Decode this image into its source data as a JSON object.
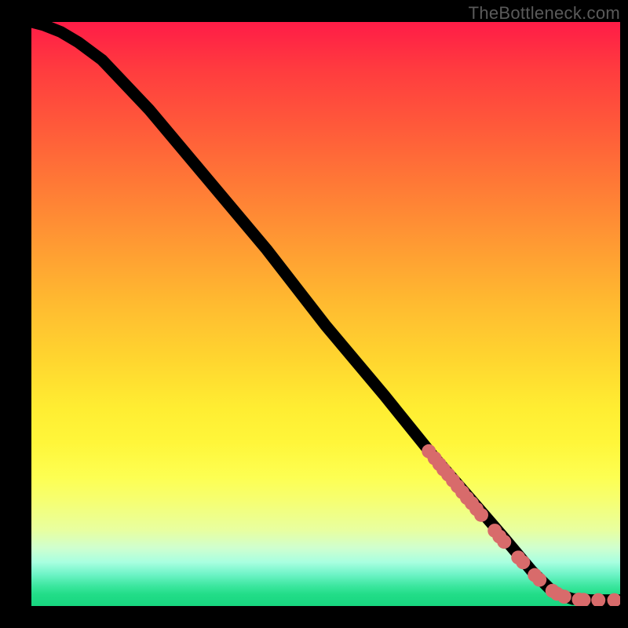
{
  "watermark": "TheBottleneck.com",
  "chart_data": {
    "type": "line",
    "title": "",
    "xlabel": "",
    "ylabel": "",
    "xlim": [
      0,
      100
    ],
    "ylim": [
      0,
      100
    ],
    "curve": [
      {
        "x": 0,
        "y": 100
      },
      {
        "x": 2,
        "y": 99.5
      },
      {
        "x": 5,
        "y": 98.3
      },
      {
        "x": 8,
        "y": 96.5
      },
      {
        "x": 12,
        "y": 93.5
      },
      {
        "x": 20,
        "y": 85
      },
      {
        "x": 30,
        "y": 73
      },
      {
        "x": 40,
        "y": 61
      },
      {
        "x": 50,
        "y": 48
      },
      {
        "x": 60,
        "y": 36
      },
      {
        "x": 68,
        "y": 26
      },
      {
        "x": 74,
        "y": 19
      },
      {
        "x": 80,
        "y": 12
      },
      {
        "x": 85,
        "y": 6
      },
      {
        "x": 88,
        "y": 3
      },
      {
        "x": 90,
        "y": 1.8
      },
      {
        "x": 92,
        "y": 1.2
      },
      {
        "x": 95,
        "y": 1.0
      },
      {
        "x": 100,
        "y": 1.0
      }
    ],
    "markers": [
      {
        "x": 67.5,
        "y": 26.5,
        "r": 1.2
      },
      {
        "x": 68.5,
        "y": 25.3,
        "r": 1.2
      },
      {
        "x": 69.3,
        "y": 24.3,
        "r": 1.2
      },
      {
        "x": 70.0,
        "y": 23.4,
        "r": 1.2
      },
      {
        "x": 70.8,
        "y": 22.5,
        "r": 1.2
      },
      {
        "x": 71.6,
        "y": 21.5,
        "r": 1.2
      },
      {
        "x": 72.4,
        "y": 20.5,
        "r": 1.2
      },
      {
        "x": 73.2,
        "y": 19.5,
        "r": 1.2
      },
      {
        "x": 74.0,
        "y": 18.5,
        "r": 1.2
      },
      {
        "x": 74.8,
        "y": 17.6,
        "r": 1.2
      },
      {
        "x": 75.6,
        "y": 16.6,
        "r": 1.2
      },
      {
        "x": 76.4,
        "y": 15.6,
        "r": 1.2
      },
      {
        "x": 78.7,
        "y": 12.9,
        "r": 1.2
      },
      {
        "x": 79.5,
        "y": 11.9,
        "r": 1.2
      },
      {
        "x": 80.3,
        "y": 11.0,
        "r": 1.2
      },
      {
        "x": 82.7,
        "y": 8.3,
        "r": 1.2
      },
      {
        "x": 83.5,
        "y": 7.5,
        "r": 1.2
      },
      {
        "x": 85.5,
        "y": 5.3,
        "r": 1.2
      },
      {
        "x": 86.3,
        "y": 4.5,
        "r": 1.2
      },
      {
        "x": 88.5,
        "y": 2.6,
        "r": 1.2
      },
      {
        "x": 89.3,
        "y": 2.1,
        "r": 1.2
      },
      {
        "x": 90.5,
        "y": 1.6,
        "r": 1.2
      },
      {
        "x": 93.0,
        "y": 1.1,
        "r": 1.2
      },
      {
        "x": 93.8,
        "y": 1.05,
        "r": 1.2
      },
      {
        "x": 96.3,
        "y": 1.0,
        "r": 1.2
      },
      {
        "x": 99.0,
        "y": 1.0,
        "r": 1.2
      }
    ],
    "marker_color": "#d86b6b"
  }
}
